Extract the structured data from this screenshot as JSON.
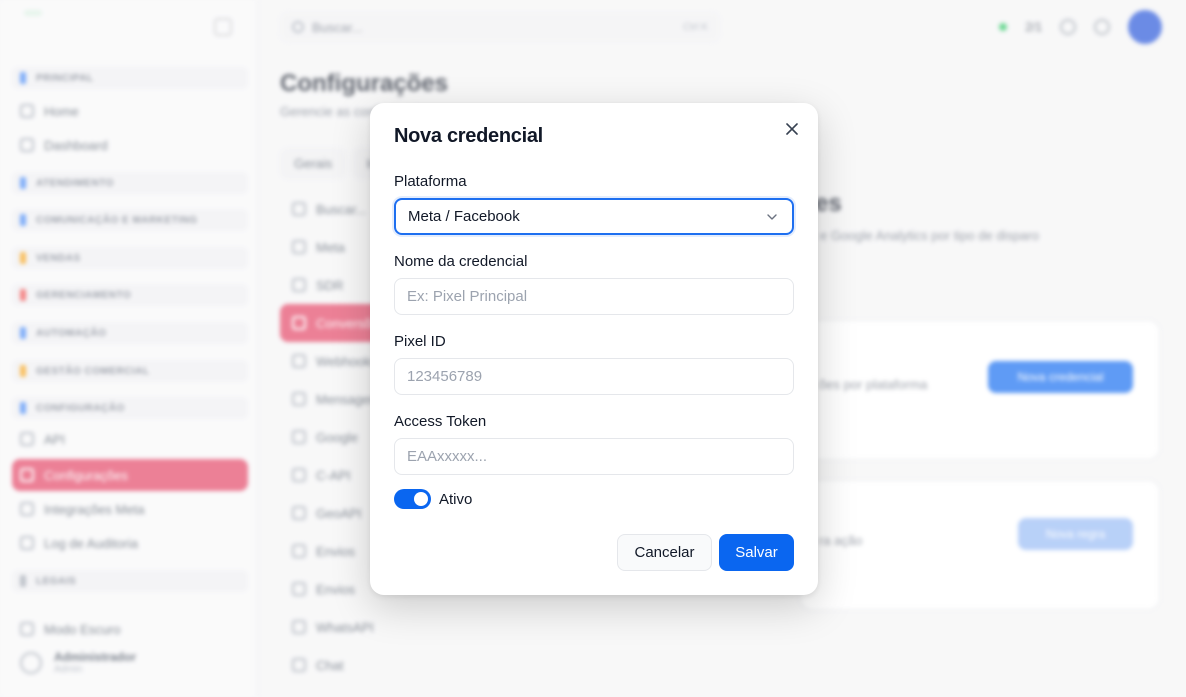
{
  "background": {
    "sidebar": {
      "sections": [
        {
          "label": "PRINCIPAL",
          "color": "#3b82f6"
        },
        {
          "label": "ATENDIMENTO",
          "color": "#3b82f6"
        },
        {
          "label": "COMUNICAÇÃO E MARKETING",
          "color": "#3b82f6"
        },
        {
          "label": "VENDAS",
          "color": "#f59e0b"
        },
        {
          "label": "GERENCIAMENTO",
          "color": "#ef4444"
        },
        {
          "label": "AUTOMAÇÃO",
          "color": "#3b82f6"
        },
        {
          "label": "GESTÃO COMERCIAL",
          "color": "#f59e0b"
        },
        {
          "label": "CONFIGURAÇÃO",
          "color": "#3b82f6"
        },
        {
          "label": "LEGAIS",
          "color": "#9ca3af"
        }
      ],
      "items": [
        "Home",
        "Dashboard",
        "API",
        "Configurações",
        "Integrações Meta",
        "Log de Auditoria"
      ],
      "footer_link": "Modo Escuro",
      "user_name": "Administrador",
      "user_role": "Admin"
    },
    "topbar": {
      "search_placeholder": "Buscar...",
      "shortcut": "Ctrl K",
      "online_count": "2/1"
    },
    "main": {
      "title": "Configurações",
      "subtitle": "Gerencie as configurações do sistema",
      "tabs": [
        "Gerais",
        "Integrações"
      ],
      "subnav": [
        "Buscar...",
        "Meta",
        "SDR",
        "Conversões",
        "Webhooks",
        "Mensagens",
        "Google",
        "C-API",
        "GeoAPI",
        "Envios",
        "Envios",
        "WhatsAPI",
        "Chat"
      ],
      "right_heading": "es",
      "right_text": "e Google Analytics por tipo de disparo",
      "card1_text": "ões por plataforma",
      "card1_button": "Nova credencial",
      "card2_text": "ra ação",
      "card2_button": "Nova regra"
    }
  },
  "modal": {
    "title": "Nova credencial",
    "fields": {
      "platform": {
        "label": "Plataforma",
        "value": "Meta / Facebook"
      },
      "name": {
        "label": "Nome da credencial",
        "placeholder": "Ex: Pixel Principal"
      },
      "pixel_id": {
        "label": "Pixel ID",
        "placeholder": "123456789"
      },
      "access_token": {
        "label": "Access Token",
        "placeholder": "EAAxxxxx..."
      }
    },
    "toggle": {
      "label": "Ativo",
      "on": true
    },
    "cancel_label": "Cancelar",
    "save_label": "Salvar"
  },
  "icons": [
    "close-icon",
    "chevron-down-icon"
  ],
  "colors": {
    "accent": "#0a66f0",
    "active_nav": "#e23d5f"
  }
}
